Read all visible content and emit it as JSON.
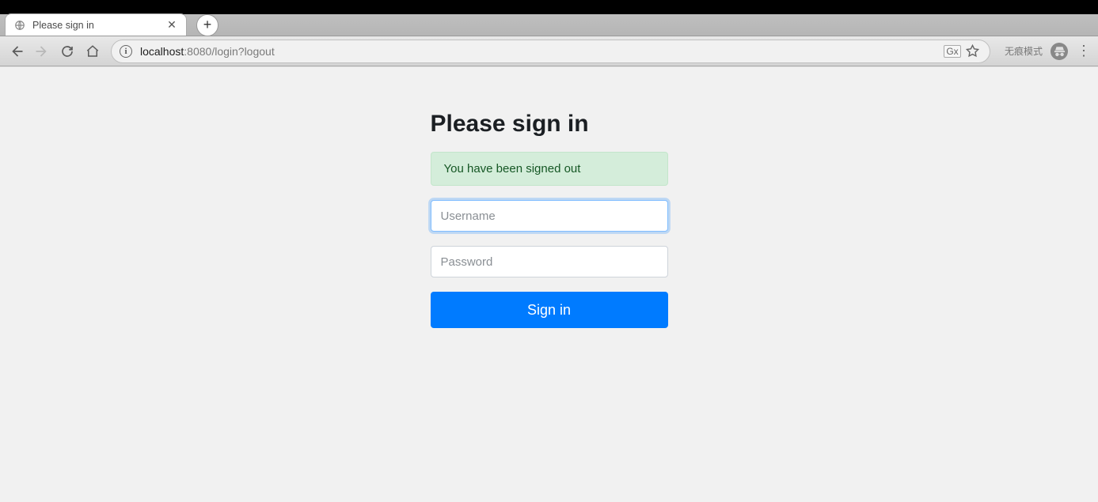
{
  "window": {
    "minimize": "–",
    "maximize": "❐",
    "close": "✕"
  },
  "tab": {
    "title": "Please sign in",
    "close": "✕"
  },
  "newTab": "+",
  "url": {
    "info": "i",
    "host": "localhost",
    "port": ":8080",
    "path": "/login?logout"
  },
  "translate_label": "Gx",
  "incognito": {
    "label": "无痕模式",
    "icon": "☻"
  },
  "menu": "⋮",
  "page": {
    "heading": "Please sign in",
    "alert": "You have been signed out",
    "username_placeholder": "Username",
    "password_placeholder": "Password",
    "signin_button": "Sign in"
  }
}
